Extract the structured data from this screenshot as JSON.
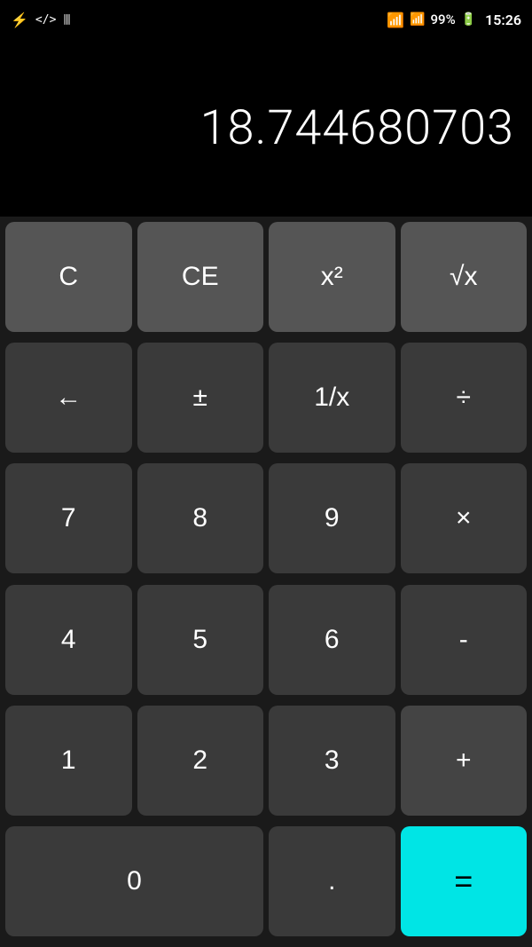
{
  "statusBar": {
    "leftIcons": [
      "usb",
      "code",
      "barcode"
    ],
    "wifi": "wifi",
    "signal": "signal",
    "battery": "99%",
    "time": "15:26"
  },
  "display": {
    "value": "18.744680703"
  },
  "buttons": {
    "row1": [
      {
        "id": "btn-c",
        "label": "C",
        "type": "light-gray"
      },
      {
        "id": "btn-ce",
        "label": "CE",
        "type": "light-gray"
      },
      {
        "id": "btn-x2",
        "label": "x²",
        "type": "light-gray"
      },
      {
        "id": "btn-sqrt",
        "label": "√x",
        "type": "light-gray"
      }
    ],
    "row2": [
      {
        "id": "btn-back",
        "label": "←",
        "type": "dark-gray"
      },
      {
        "id": "btn-plusminus",
        "label": "±",
        "type": "dark-gray"
      },
      {
        "id": "btn-inv",
        "label": "1/x",
        "type": "dark-gray"
      },
      {
        "id": "btn-div",
        "label": "÷",
        "type": "dark-gray"
      }
    ],
    "row3": [
      {
        "id": "btn-7",
        "label": "7",
        "type": "dark-gray"
      },
      {
        "id": "btn-8",
        "label": "8",
        "type": "dark-gray"
      },
      {
        "id": "btn-9",
        "label": "9",
        "type": "dark-gray"
      },
      {
        "id": "btn-mul",
        "label": "×",
        "type": "dark-gray"
      }
    ],
    "row4": [
      {
        "id": "btn-4",
        "label": "4",
        "type": "dark-gray"
      },
      {
        "id": "btn-5",
        "label": "5",
        "type": "dark-gray"
      },
      {
        "id": "btn-6",
        "label": "6",
        "type": "dark-gray"
      },
      {
        "id": "btn-sub",
        "label": "-",
        "type": "dark-gray"
      }
    ],
    "row5": [
      {
        "id": "btn-1",
        "label": "1",
        "type": "dark-gray"
      },
      {
        "id": "btn-2",
        "label": "2",
        "type": "dark-gray"
      },
      {
        "id": "btn-3",
        "label": "3",
        "type": "dark-gray"
      },
      {
        "id": "btn-add",
        "label": "+",
        "type": "operator"
      }
    ],
    "row6": [
      {
        "id": "btn-0",
        "label": "0",
        "type": "dark-gray",
        "span": 2
      },
      {
        "id": "btn-dot",
        "label": ".",
        "type": "dark-gray"
      },
      {
        "id": "btn-eq",
        "label": "=",
        "type": "equals"
      }
    ]
  }
}
